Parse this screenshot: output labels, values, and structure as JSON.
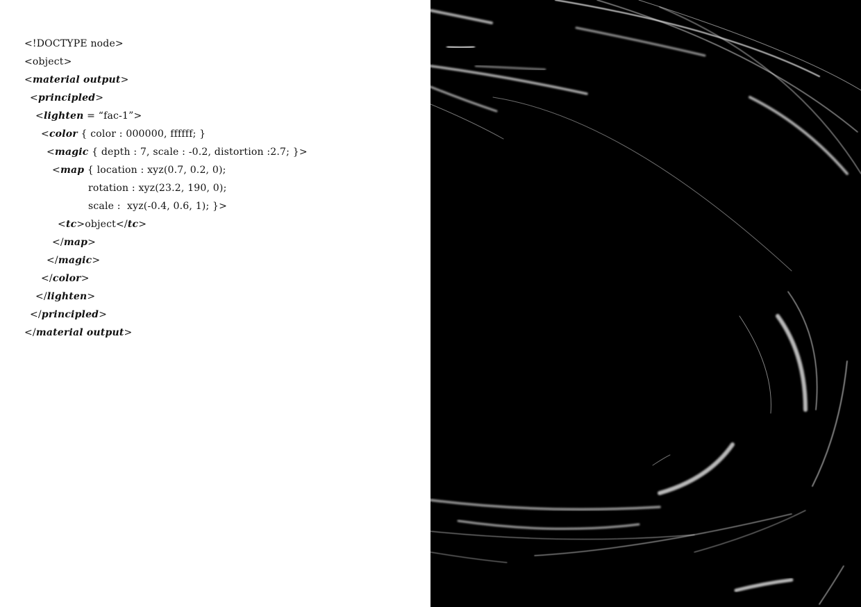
{
  "code_lines": [
    {
      "t": "<!DOCTYPE node>"
    },
    {
      "t": "<object>"
    },
    {
      "a": "<",
      "n": "material output",
      "b": ">"
    },
    {
      "a": "<",
      "n": "principled",
      "b": ">"
    },
    {
      "a": "<",
      "n": "lighten",
      "b": " = “fac-1”>"
    },
    {
      "a": "<",
      "n": "color",
      "b": " { color : 000000, ffffff; }"
    },
    {
      "a": "<",
      "n": "magic",
      "b": " { depth : 7, scale : -0.2, distortion :2.7; }>"
    },
    {
      "a": "<",
      "n": "map",
      "b": " { location : xyz(0.7, 0.2, 0);"
    },
    {
      "t": "rotation : xyz(23.2, 190, 0);"
    },
    {
      "t": "scale :  xyz(-0.4, 0.6, 1); }>"
    },
    {
      "a": "<",
      "n": "tc",
      "b": ">object</",
      "n2": "tc",
      "c": ">"
    },
    {
      "a": "</",
      "n": "map",
      "b": ">"
    },
    {
      "a": "</",
      "n": "magic",
      "b": ">"
    },
    {
      "a": "</",
      "n": "color",
      "b": ">"
    },
    {
      "a": "</",
      "n": "lighten",
      "b": ">"
    },
    {
      "a": "</",
      "n": "principled",
      "b": ">"
    },
    {
      "a": "</",
      "n": "material output",
      "b": ">"
    }
  ],
  "colors": {
    "left_page_background": "#ffffff",
    "right_page_background": "#000000",
    "text": "#111111",
    "swirl_highlight": "#d9d9d9"
  }
}
